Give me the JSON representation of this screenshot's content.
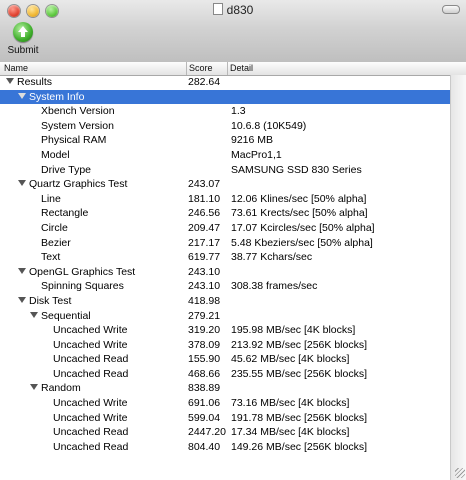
{
  "window": {
    "title": "d830"
  },
  "toolbar": {
    "submit_label": "Submit"
  },
  "columns": {
    "name": "Name",
    "score": "Score",
    "detail": "Detail"
  },
  "rows": [
    {
      "name": "Results",
      "score": "282.64",
      "detail": "",
      "indent": 0,
      "toggle": true,
      "selected": false
    },
    {
      "name": "System Info",
      "score": "",
      "detail": "",
      "indent": 1,
      "toggle": true,
      "selected": true
    },
    {
      "name": "Xbench Version",
      "score": "",
      "detail": "1.3",
      "indent": 2,
      "toggle": false,
      "selected": false
    },
    {
      "name": "System Version",
      "score": "",
      "detail": "10.6.8 (10K549)",
      "indent": 2,
      "toggle": false,
      "selected": false
    },
    {
      "name": "Physical RAM",
      "score": "",
      "detail": "9216 MB",
      "indent": 2,
      "toggle": false,
      "selected": false
    },
    {
      "name": "Model",
      "score": "",
      "detail": "MacPro1,1",
      "indent": 2,
      "toggle": false,
      "selected": false
    },
    {
      "name": "Drive Type",
      "score": "",
      "detail": "SAMSUNG SSD 830 Series",
      "indent": 2,
      "toggle": false,
      "selected": false
    },
    {
      "name": "Quartz Graphics Test",
      "score": "243.07",
      "detail": "",
      "indent": 1,
      "toggle": true,
      "selected": false
    },
    {
      "name": "Line",
      "score": "181.10",
      "detail": "12.06 Klines/sec [50% alpha]",
      "indent": 2,
      "toggle": false,
      "selected": false
    },
    {
      "name": "Rectangle",
      "score": "246.56",
      "detail": "73.61 Krects/sec [50% alpha]",
      "indent": 2,
      "toggle": false,
      "selected": false
    },
    {
      "name": "Circle",
      "score": "209.47",
      "detail": "17.07 Kcircles/sec [50% alpha]",
      "indent": 2,
      "toggle": false,
      "selected": false
    },
    {
      "name": "Bezier",
      "score": "217.17",
      "detail": "5.48 Kbeziers/sec [50% alpha]",
      "indent": 2,
      "toggle": false,
      "selected": false
    },
    {
      "name": "Text",
      "score": "619.77",
      "detail": "38.77 Kchars/sec",
      "indent": 2,
      "toggle": false,
      "selected": false
    },
    {
      "name": "OpenGL Graphics Test",
      "score": "243.10",
      "detail": "",
      "indent": 1,
      "toggle": true,
      "selected": false
    },
    {
      "name": "Spinning Squares",
      "score": "243.10",
      "detail": "308.38 frames/sec",
      "indent": 2,
      "toggle": false,
      "selected": false
    },
    {
      "name": "Disk Test",
      "score": "418.98",
      "detail": "",
      "indent": 1,
      "toggle": true,
      "selected": false
    },
    {
      "name": "Sequential",
      "score": "279.21",
      "detail": "",
      "indent": 2,
      "toggle": true,
      "selected": false
    },
    {
      "name": "Uncached Write",
      "score": "319.20",
      "detail": "195.98 MB/sec [4K blocks]",
      "indent": 3,
      "toggle": false,
      "selected": false
    },
    {
      "name": "Uncached Write",
      "score": "378.09",
      "detail": "213.92 MB/sec [256K blocks]",
      "indent": 3,
      "toggle": false,
      "selected": false
    },
    {
      "name": "Uncached Read",
      "score": "155.90",
      "detail": "45.62 MB/sec [4K blocks]",
      "indent": 3,
      "toggle": false,
      "selected": false
    },
    {
      "name": "Uncached Read",
      "score": "468.66",
      "detail": "235.55 MB/sec [256K blocks]",
      "indent": 3,
      "toggle": false,
      "selected": false
    },
    {
      "name": "Random",
      "score": "838.89",
      "detail": "",
      "indent": 2,
      "toggle": true,
      "selected": false
    },
    {
      "name": "Uncached Write",
      "score": "691.06",
      "detail": "73.16 MB/sec [4K blocks]",
      "indent": 3,
      "toggle": false,
      "selected": false
    },
    {
      "name": "Uncached Write",
      "score": "599.04",
      "detail": "191.78 MB/sec [256K blocks]",
      "indent": 3,
      "toggle": false,
      "selected": false
    },
    {
      "name": "Uncached Read",
      "score": "2447.20",
      "detail": "17.34 MB/sec [4K blocks]",
      "indent": 3,
      "toggle": false,
      "selected": false
    },
    {
      "name": "Uncached Read",
      "score": "804.40",
      "detail": "149.26 MB/sec [256K blocks]",
      "indent": 3,
      "toggle": false,
      "selected": false
    }
  ]
}
